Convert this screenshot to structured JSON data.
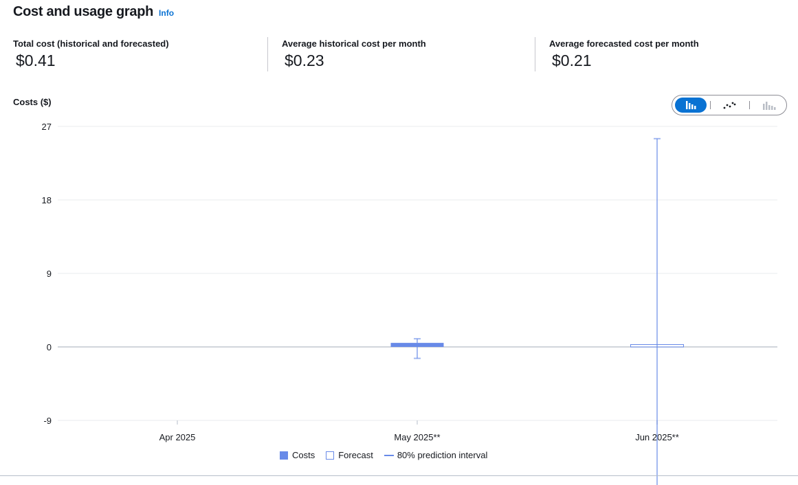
{
  "header": {
    "title": "Cost and usage graph",
    "info_label": "Info"
  },
  "metrics": [
    {
      "label": "Total cost (historical and forecasted)",
      "value": "$0.41"
    },
    {
      "label": "Average historical cost per month",
      "value": "$0.23"
    },
    {
      "label": "Average forecasted cost per month",
      "value": "$0.21"
    }
  ],
  "chart_controls": {
    "options": [
      "bar-chart-icon",
      "line-chart-icon",
      "stacked-bar-chart-icon"
    ],
    "selected": "bar-chart-icon",
    "accent_color": "#0972d3"
  },
  "chart_data": {
    "type": "bar",
    "ylabel": "Costs ($)",
    "ylim": [
      -9,
      27
    ],
    "yticks": [
      27,
      18,
      9,
      0,
      -9
    ],
    "categories": [
      "Apr 2025",
      "May 2025**",
      "Jun 2025**"
    ],
    "series": [
      {
        "name": "Costs",
        "values": [
          0,
          0.41,
          0
        ],
        "color": "#688ae8"
      },
      {
        "name": "Forecast",
        "values": [
          0,
          0,
          0.21
        ],
        "color": "#688ae8"
      }
    ],
    "prediction_interval": {
      "name": "80% prediction interval",
      "ranges": [
        null,
        [
          -1.4,
          1.0
        ],
        [
          -19.0,
          25.5
        ]
      ]
    },
    "grid": true,
    "legend_position": "bottom"
  }
}
